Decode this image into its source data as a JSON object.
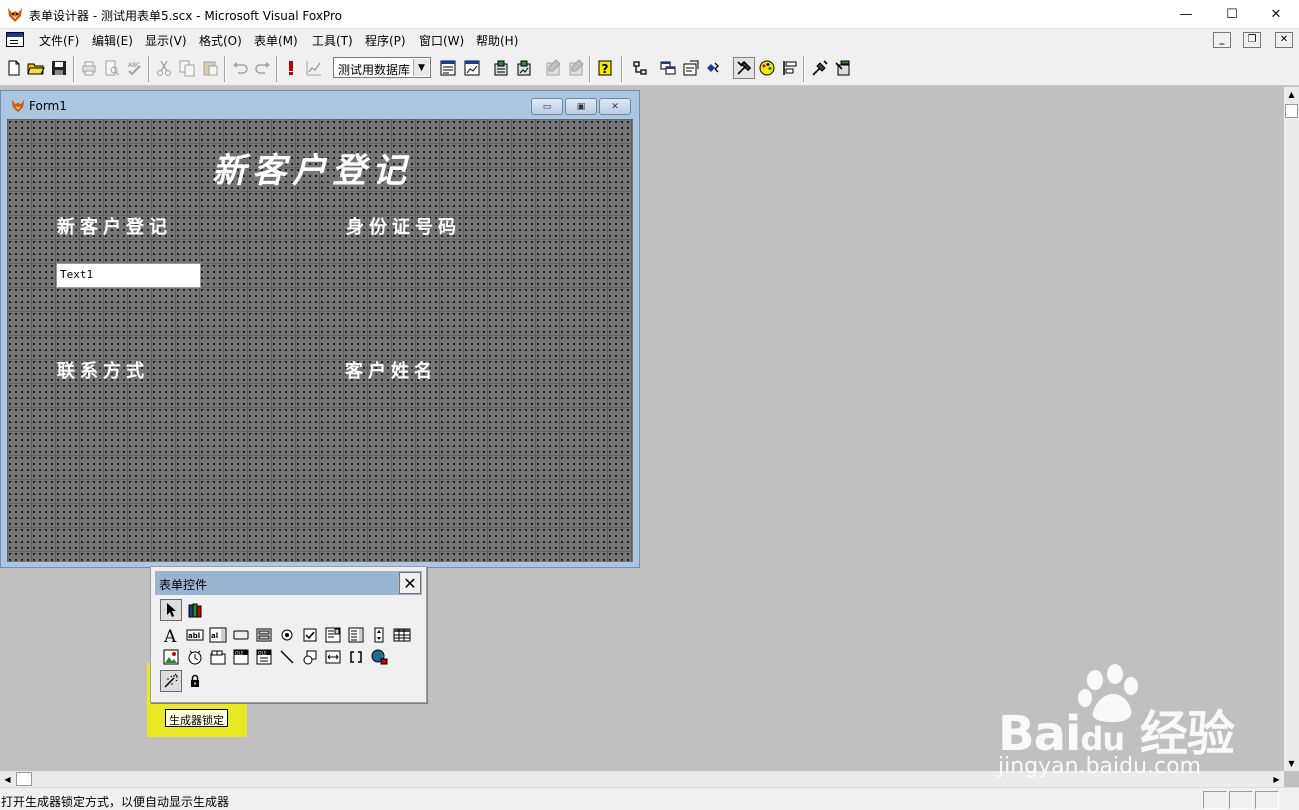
{
  "titlebar": {
    "title": "表单设计器 - 测试用表单5.scx - Microsoft Visual FoxPro",
    "minimize": "—",
    "maximize": "☐",
    "close": "✕"
  },
  "menubar": {
    "items": [
      {
        "label": "文件(F)"
      },
      {
        "label": "编辑(E)"
      },
      {
        "label": "显示(V)"
      },
      {
        "label": "格式(O)"
      },
      {
        "label": "表单(M)"
      },
      {
        "label": "工具(T)"
      },
      {
        "label": "程序(P)"
      },
      {
        "label": "窗口(W)"
      },
      {
        "label": "帮助(H)"
      }
    ],
    "mdi_minimize": "_",
    "mdi_restore": "❐",
    "mdi_close": "✕"
  },
  "toolbar": {
    "database_combo": "测试用数据库",
    "combo_arrow": "▼"
  },
  "form_window": {
    "title": "Form1",
    "minimize": "▭",
    "restore": "▣",
    "close": "✕",
    "heading": "新客户登记",
    "labels": {
      "new_customer": "新客户登记",
      "id_number": "身份证号码",
      "contact": "联系方式",
      "customer_name": "客户姓名"
    },
    "textbox": "Text1"
  },
  "controls_toolbar": {
    "title": "表单控件",
    "close": "✕",
    "tooltip": "生成器锁定"
  },
  "statusbar": {
    "text": "打开生成器锁定方式，以便自动显示生成器"
  },
  "scrollbars": {
    "up": "▲",
    "down": "▼",
    "left": "◀",
    "right": "▶"
  },
  "watermark": {
    "brand_bai": "Bai",
    "brand_du": "du",
    "brand_cn": "经验",
    "url": "jingyan.baidu.com"
  }
}
